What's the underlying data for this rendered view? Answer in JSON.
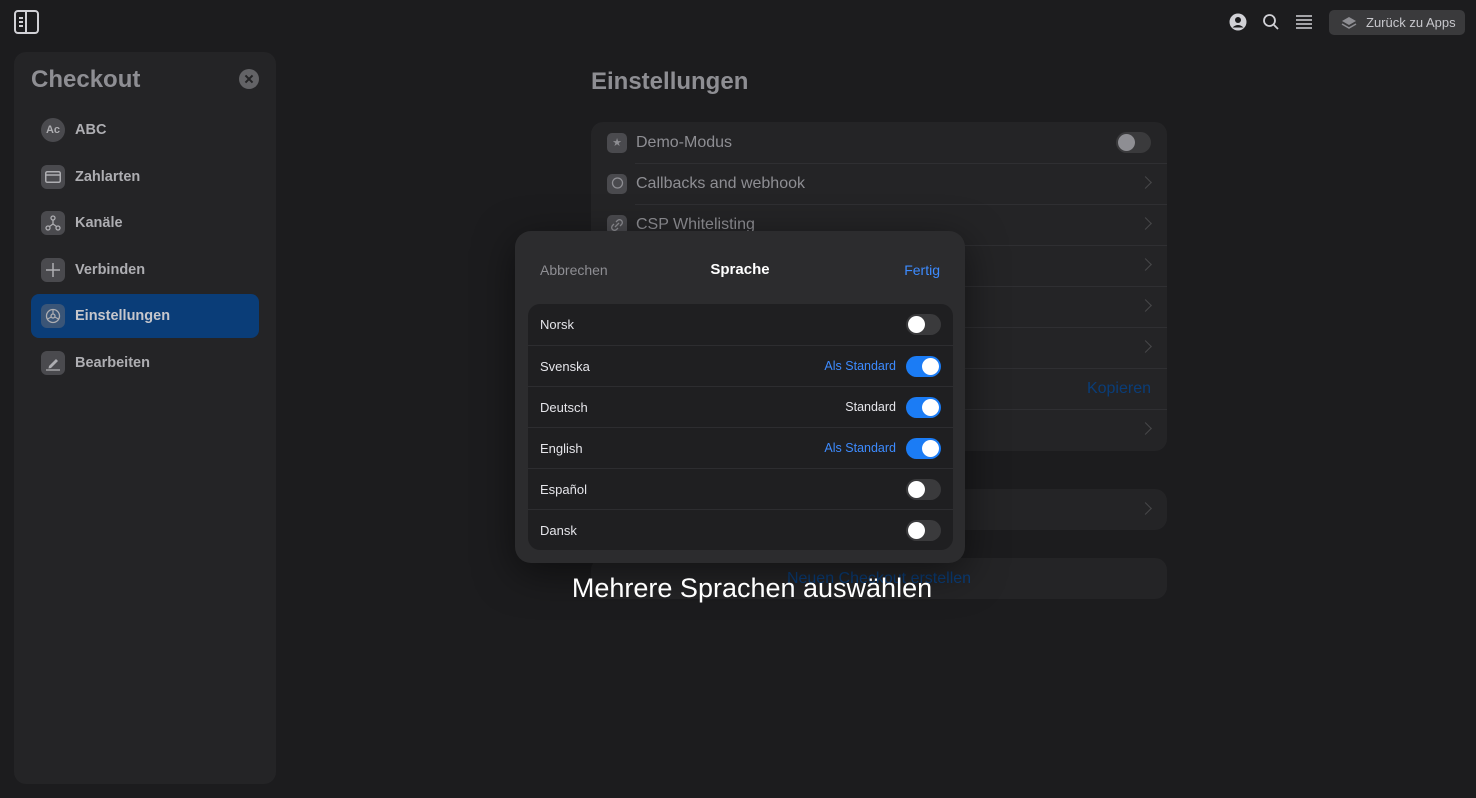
{
  "topbar": {
    "back_label": "Zurück zu Apps"
  },
  "sidebar": {
    "title": "Checkout",
    "items": [
      {
        "label": "ABC",
        "icon_text": "Ac"
      },
      {
        "label": "Zahlarten"
      },
      {
        "label": "Kanäle"
      },
      {
        "label": "Verbinden"
      },
      {
        "label": "Einstellungen",
        "active": true
      },
      {
        "label": "Bearbeiten"
      }
    ]
  },
  "main": {
    "title": "Einstellungen",
    "rows": [
      {
        "label": "Demo-Modus"
      },
      {
        "label": "Callbacks and webhook"
      },
      {
        "label": "CSP Whitelisting"
      }
    ],
    "copy_label": "Kopieren",
    "new_button": "Neuen Checkout erstellen"
  },
  "modal": {
    "cancel": "Abbrechen",
    "title": "Sprache",
    "done": "Fertig",
    "languages": [
      {
        "name": "Norsk",
        "standard": "",
        "enabled": false
      },
      {
        "name": "Svenska",
        "standard": "Als Standard",
        "enabled": true
      },
      {
        "name": "Deutsch",
        "standard": "Standard",
        "enabled": true
      },
      {
        "name": "English",
        "standard": "Als Standard",
        "enabled": true
      },
      {
        "name": "Español",
        "standard": "",
        "enabled": false
      },
      {
        "name": "Dansk",
        "standard": "",
        "enabled": false
      }
    ]
  },
  "caption": "Mehrere Sprachen auswählen",
  "colors": {
    "accent": "#1b7cf5",
    "active_item": "#0a3d78"
  }
}
